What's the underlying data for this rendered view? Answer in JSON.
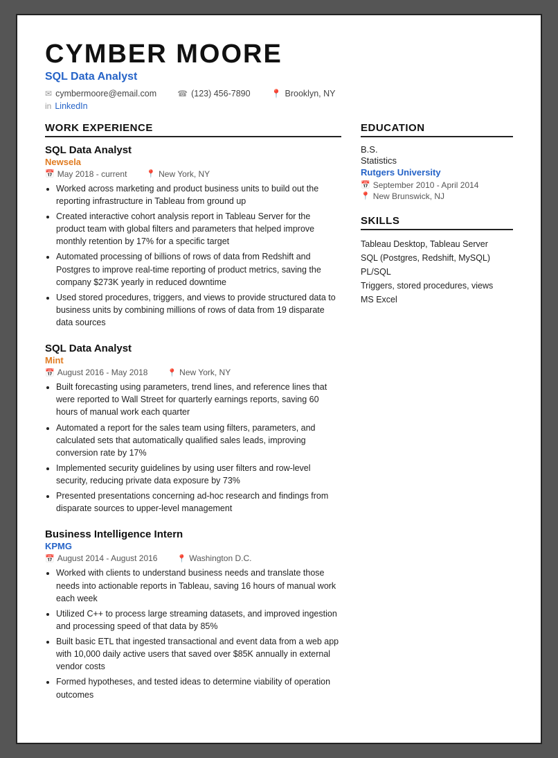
{
  "header": {
    "name": "CYMBER  MOORE",
    "title": "SQL Data Analyst",
    "email": "cymbermoore@email.com",
    "phone": "(123) 456-7890",
    "location": "Brooklyn, NY",
    "linkedin_label": "LinkedIn",
    "linkedin_url": "#"
  },
  "sections": {
    "work_experience_label": "WORK EXPERIENCE",
    "education_label": "EDUCATION",
    "skills_label": "SKILLS"
  },
  "work_experience": [
    {
      "job_title": "SQL Data Analyst",
      "company": "Newsela",
      "company_color": "orange",
      "date_range": "May 2018 - current",
      "location": "New York, NY",
      "bullets": [
        "Worked across marketing and product business units to build out the reporting infrastructure in Tableau from ground up",
        "Created interactive cohort analysis report in Tableau Server for the product team with global filters and parameters that helped improve monthly retention by 17% for a specific target",
        "Automated processing of billions of rows of data from Redshift and Postgres to improve real-time reporting of product metrics, saving the company $273K yearly in reduced downtime",
        "Used stored procedures, triggers, and views to provide structured data to business units by combining millions of rows of data from 19 disparate data sources"
      ]
    },
    {
      "job_title": "SQL Data Analyst",
      "company": "Mint",
      "company_color": "orange",
      "date_range": "August 2016 - May 2018",
      "location": "New York, NY",
      "bullets": [
        "Built forecasting using parameters, trend lines, and reference lines that were reported to Wall Street for quarterly earnings reports, saving 60 hours of manual work each quarter",
        "Automated a report for the sales team using filters, parameters, and calculated sets that automatically qualified sales leads, improving conversion rate by 17%",
        "Implemented security guidelines by using user filters and row-level security, reducing private data exposure by 73%",
        "Presented presentations concerning ad-hoc research and findings from disparate sources to upper-level management"
      ]
    },
    {
      "job_title": "Business Intelligence Intern",
      "company": "KPMG",
      "company_color": "blue",
      "date_range": "August 2014 - August 2016",
      "location": "Washington D.C.",
      "bullets": [
        "Worked with clients to understand business needs and translate those needs into actionable reports in Tableau, saving 16 hours of manual work each week",
        "Utilized C++ to process large streaming datasets, and improved ingestion and processing speed of that data by 85%",
        "Built basic ETL that ingested transactional and event data from a web app with 10,000 daily active users that saved over $85K annually in external vendor costs",
        "Formed hypotheses, and tested ideas to determine viability of operation outcomes"
      ]
    }
  ],
  "education": {
    "degree": "B.S.",
    "field": "Statistics",
    "university": "Rutgers University",
    "date_range": "September 2010 - April 2014",
    "location": "New Brunswick, NJ"
  },
  "skills": [
    "Tableau Desktop, Tableau Server",
    "SQL (Postgres, Redshift, MySQL)",
    "PL/SQL",
    "Triggers, stored procedures, views",
    "MS Excel"
  ]
}
